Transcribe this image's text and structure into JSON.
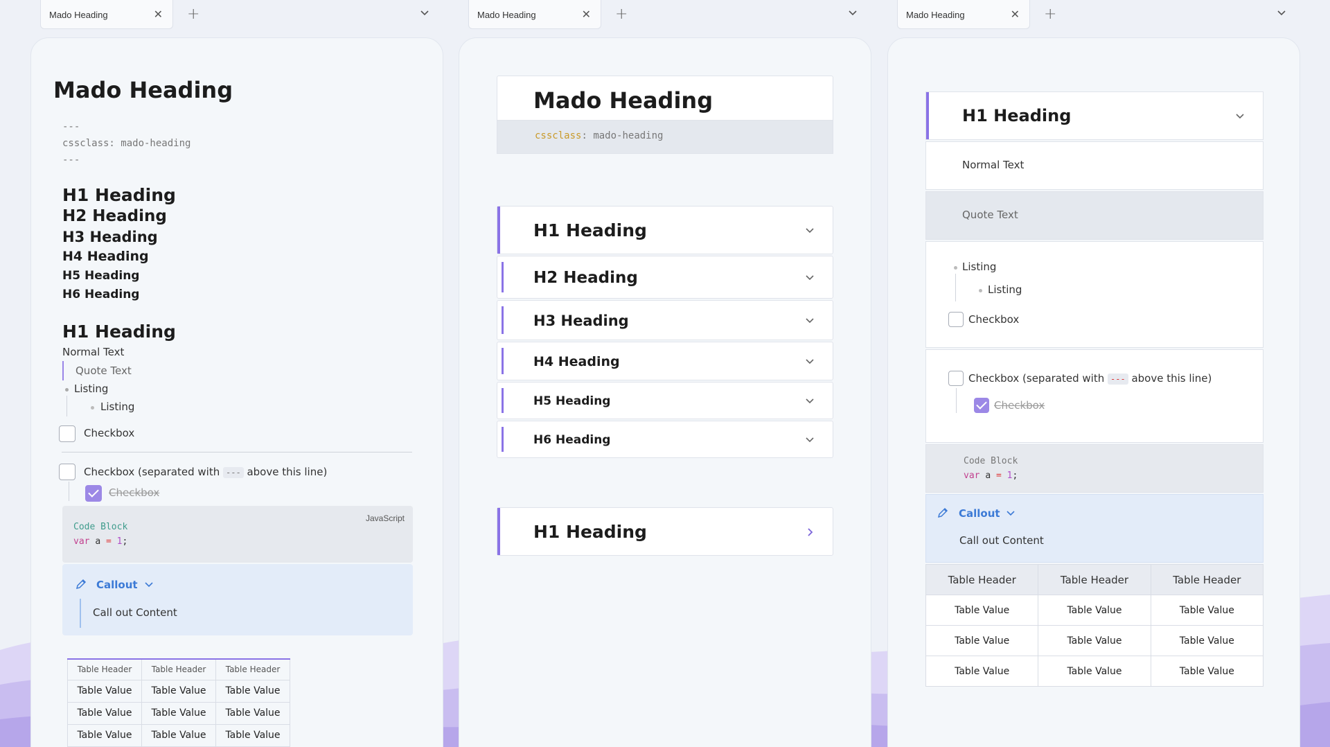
{
  "colors": {
    "accent": "#8a73e6",
    "callout": "#3c7ad6",
    "panel": "#f4f7fa"
  },
  "tab": {
    "title": "Mado Heading"
  },
  "col1": {
    "title": "Mado Heading",
    "frontmatter": [
      "---",
      "cssclass: mado-heading",
      "---"
    ],
    "headings": [
      "H1 Heading",
      "H2 Heading",
      "H3 Heading",
      "H4 Heading",
      "H5 Heading",
      "H6 Heading"
    ],
    "h1_again": "H1 Heading",
    "normal": "Normal Text",
    "quote": "Quote Text",
    "listing1": "Listing",
    "listing2": "Listing",
    "checkbox1": "Checkbox",
    "checkbox2_pre": "Checkbox (separated with",
    "checkbox2_code": "---",
    "checkbox2_post": "above this line)",
    "checkbox3": "Checkbox",
    "code_lang": "JavaScript",
    "code_line1": "Code Block",
    "code_kw": "var",
    "code_ident": "a",
    "code_op": "=",
    "code_num": "1",
    "code_end": ";",
    "callout_title": "Callout",
    "callout_content": "Call out Content",
    "table": {
      "headers": [
        "Table Header",
        "Table Header",
        "Table Header"
      ],
      "rows": [
        [
          "Table Value",
          "Table Value",
          "Table Value"
        ],
        [
          "Table Value",
          "Table Value",
          "Table Value"
        ],
        [
          "Table Value",
          "Table Value",
          "Table Value"
        ]
      ]
    }
  },
  "col2": {
    "title": "Mado Heading",
    "fm_key": "cssclass",
    "fm_colon": ":",
    "fm_value": "mado-heading",
    "headings": [
      "H1 Heading",
      "H2 Heading",
      "H3 Heading",
      "H4 Heading",
      "H5 Heading",
      "H6 Heading"
    ],
    "collapsed": "H1 Heading"
  },
  "col3": {
    "h1": "H1 Heading",
    "normal": "Normal Text",
    "quote": "Quote Text",
    "listing1": "Listing",
    "listing2": "Listing",
    "checkbox1": "Checkbox",
    "checkbox2_pre": "Checkbox (separated with",
    "checkbox2_code": "---",
    "checkbox2_post": "above this line)",
    "checkbox3": "Checkbox",
    "code_line1": "Code Block",
    "code_kw": "var",
    "code_ident": "a",
    "code_op": "=",
    "code_num": "1",
    "code_end": ";",
    "callout_title": "Callout",
    "callout_content": "Call out Content",
    "table": {
      "headers": [
        "Table Header",
        "Table Header",
        "Table Header"
      ],
      "rows": [
        [
          "Table Value",
          "Table Value",
          "Table Value"
        ],
        [
          "Table Value",
          "Table Value",
          "Table Value"
        ],
        [
          "Table Value",
          "Table Value",
          "Table Value"
        ]
      ]
    }
  }
}
